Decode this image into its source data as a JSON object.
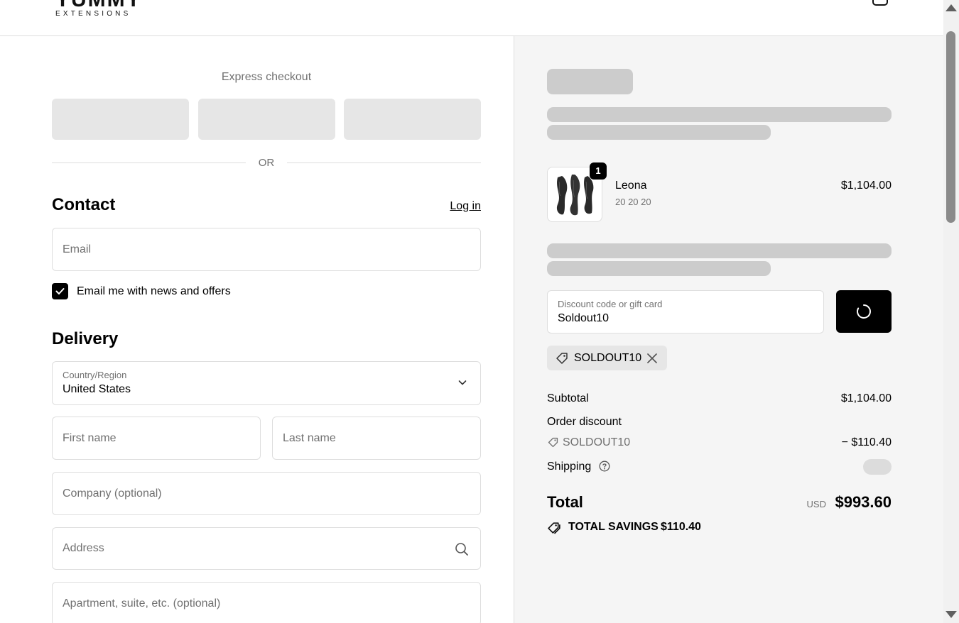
{
  "brand": {
    "name": "YUMMY",
    "tagline": "EXTENSIONS"
  },
  "express": {
    "title": "Express checkout",
    "or_text": "OR"
  },
  "contact": {
    "title": "Contact",
    "login_label": "Log in",
    "email_placeholder": "Email",
    "newsletter_label": "Email me with news and offers",
    "newsletter_checked": true
  },
  "delivery": {
    "title": "Delivery",
    "country_label": "Country/Region",
    "country_value": "United States",
    "first_name_placeholder": "First name",
    "last_name_placeholder": "Last name",
    "company_placeholder": "Company (optional)",
    "address_placeholder": "Address",
    "apartment_placeholder": "Apartment, suite, etc. (optional)"
  },
  "order": {
    "item": {
      "name": "Leona",
      "variant": "20 20 20",
      "price": "$1,104.00",
      "quantity": "1"
    },
    "discount_field": {
      "label": "Discount code or gift card",
      "value": "Soldout10"
    },
    "applied_code": "SOLDOUT10",
    "summary": {
      "subtotal_label": "Subtotal",
      "subtotal_value": "$1,104.00",
      "order_discount_label": "Order discount",
      "discount_code": "SOLDOUT10",
      "discount_value": "− $110.40",
      "shipping_label": "Shipping",
      "total_label": "Total",
      "currency": "USD",
      "total_value": "$993.60",
      "savings_label": "TOTAL SAVINGS",
      "savings_value": "$110.40"
    }
  },
  "colors": {
    "accent": "#000000",
    "summary_bg": "#f5f5f5",
    "skeleton": "#cccccc"
  }
}
